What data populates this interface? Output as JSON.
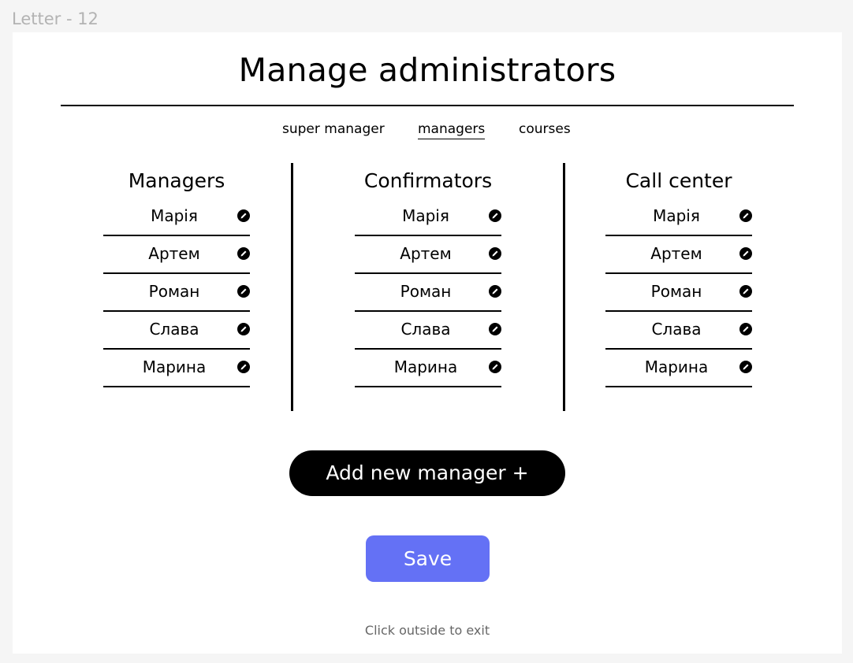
{
  "frame": {
    "label": "Letter - 12"
  },
  "title": "Manage administrators",
  "tabs": [
    {
      "label": "super manager",
      "active": false
    },
    {
      "label": "managers",
      "active": true
    },
    {
      "label": "courses",
      "active": false
    }
  ],
  "columns": [
    {
      "title": "Managers",
      "rows": [
        "Марія",
        "Артем",
        "Роман",
        "Слава",
        "Марина"
      ],
      "row_icon": "pencil-icon"
    },
    {
      "title": "Confirmators",
      "rows": [
        "Марія",
        "Артем",
        "Роман",
        "Слава",
        "Марина"
      ],
      "row_icon": "pencil-icon"
    },
    {
      "title": "Call center",
      "rows": [
        "Марія",
        "Артем",
        "Роман",
        "Слава",
        "Марина"
      ],
      "row_icon": "pencil-icon"
    }
  ],
  "actions": {
    "add_label": "Add new manager +",
    "save_label": "Save"
  },
  "hint": "Click outside to exit",
  "colors": {
    "accent": "#6471f5",
    "primary": "#000000",
    "background": "#f5f5f5"
  }
}
